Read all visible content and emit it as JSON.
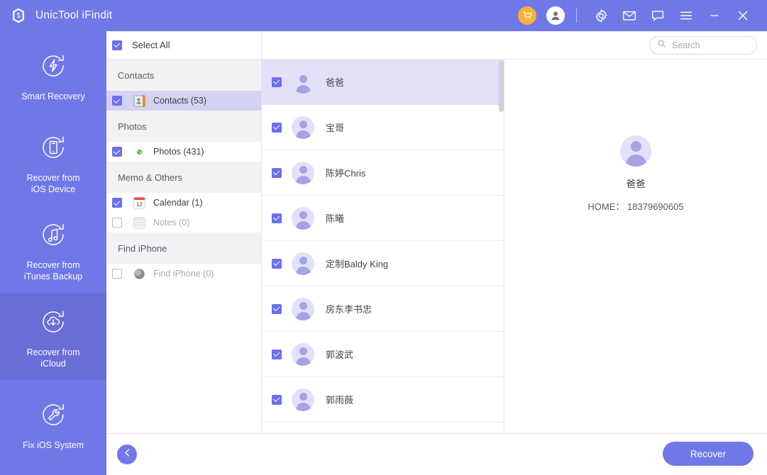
{
  "window": {
    "title": "UnicTool iFindit",
    "logo_icon": "unictool-hexagon-logo",
    "titlebar_color": "#7078e8"
  },
  "titlebar": {
    "buttons": [
      {
        "name": "cart-icon",
        "label": ""
      },
      {
        "name": "account-icon",
        "label": ""
      },
      {
        "name": "gear-icon",
        "label": ""
      },
      {
        "name": "mail-icon",
        "label": ""
      },
      {
        "name": "chat-icon",
        "label": ""
      },
      {
        "name": "menu-icon",
        "label": ""
      },
      {
        "name": "minimize-icon",
        "label": ""
      },
      {
        "name": "close-icon",
        "label": ""
      }
    ]
  },
  "sidebar": {
    "items": [
      {
        "label": "Smart Recovery",
        "icon": "bolt-refresh-icon",
        "active": false
      },
      {
        "label": "Recover from\niOS Device",
        "icon": "phone-refresh-icon",
        "active": false
      },
      {
        "label": "Recover from\niTunes Backup",
        "icon": "music-refresh-icon",
        "active": false
      },
      {
        "label": "Recover from\niCloud",
        "icon": "cloud-download-refresh-icon",
        "active": true
      },
      {
        "label": "Fix iOS System",
        "icon": "wrench-refresh-icon",
        "active": false
      }
    ]
  },
  "categories": {
    "select_all_label": "Select All",
    "select_all_checked": true,
    "groups": [
      {
        "title": "Contacts",
        "rows": [
          {
            "label": "Contacts (53)",
            "icon": "contacts-app-icon",
            "checked": true,
            "selected": true,
            "dim": false
          }
        ]
      },
      {
        "title": "Photos",
        "rows": [
          {
            "label": "Photos (431)",
            "icon": "photos-app-icon",
            "checked": true,
            "selected": false,
            "dim": false
          }
        ]
      },
      {
        "title": "Memo & Others",
        "rows": [
          {
            "label": "Calendar (1)",
            "icon": "calendar-app-icon",
            "checked": true,
            "selected": false,
            "dim": false
          },
          {
            "label": "Notes (0)",
            "icon": "notes-app-icon",
            "checked": false,
            "selected": false,
            "dim": true
          }
        ]
      },
      {
        "title": "Find iPhone",
        "rows": [
          {
            "label": "Find iPhone (0)",
            "icon": "find-iphone-app-icon",
            "checked": false,
            "selected": false,
            "dim": true
          }
        ]
      }
    ]
  },
  "search": {
    "placeholder": "Search",
    "value": "",
    "icon": "search-icon"
  },
  "contact_list": {
    "scroll_position": "top",
    "rows": [
      {
        "name": "爸爸",
        "checked": true,
        "selected": true
      },
      {
        "name": "宝哥",
        "checked": true,
        "selected": false
      },
      {
        "name": "陈婷Chris",
        "checked": true,
        "selected": false
      },
      {
        "name": "陈曦",
        "checked": true,
        "selected": false
      },
      {
        "name": "定制Baldy King",
        "checked": true,
        "selected": false
      },
      {
        "name": "房东李书忠",
        "checked": true,
        "selected": false
      },
      {
        "name": "郭波武",
        "checked": true,
        "selected": false
      },
      {
        "name": "郭雨薇",
        "checked": true,
        "selected": false
      }
    ]
  },
  "detail": {
    "avatar_icon": "person-avatar",
    "name": "爸爸",
    "phone_label": "HOME：",
    "phone_value": "18379690605"
  },
  "footer": {
    "back_label": "",
    "back_icon": "arrow-left-icon",
    "recover_label": "Recover"
  }
}
